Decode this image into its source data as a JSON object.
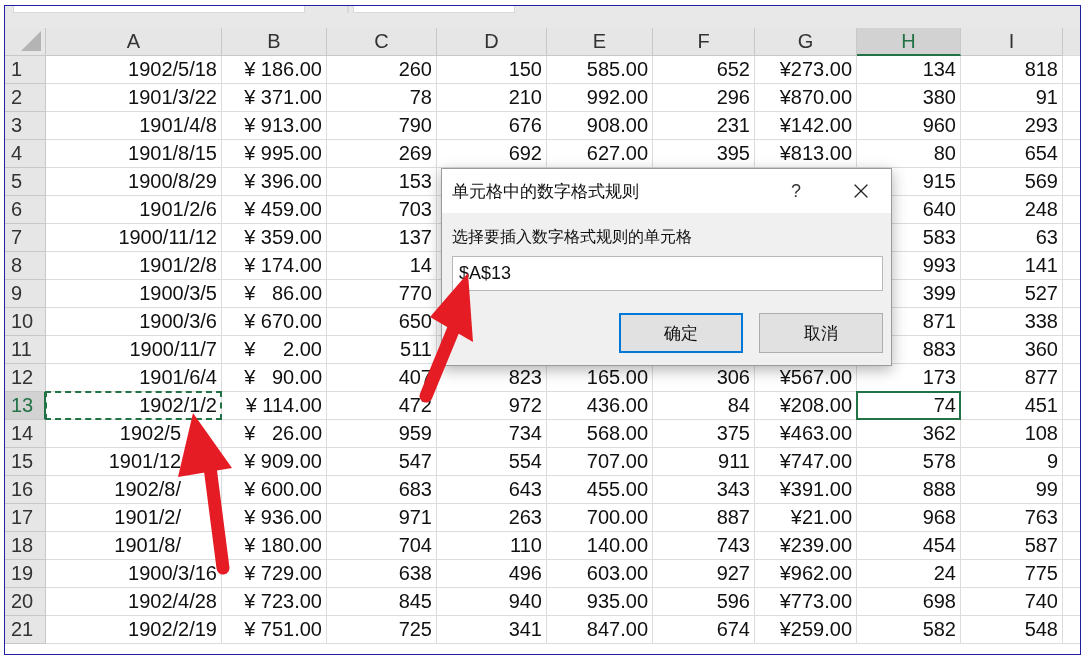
{
  "columns": [
    {
      "label": "A",
      "selected": false,
      "marquee": true
    },
    {
      "label": "B",
      "selected": false,
      "marquee": false
    },
    {
      "label": "C",
      "selected": false,
      "marquee": false
    },
    {
      "label": "D",
      "selected": false,
      "marquee": false
    },
    {
      "label": "E",
      "selected": false,
      "marquee": false
    },
    {
      "label": "F",
      "selected": false,
      "marquee": false
    },
    {
      "label": "G",
      "selected": false,
      "marquee": false
    },
    {
      "label": "H",
      "selected": true,
      "marquee": false
    },
    {
      "label": "I",
      "selected": false,
      "marquee": false
    }
  ],
  "rows": [
    {
      "label": "1",
      "selected": false,
      "cells": [
        "1902/5/18",
        "¥ 186.00",
        "260",
        "150",
        "585.00",
        "652",
        "¥273.00",
        "134",
        "818"
      ]
    },
    {
      "label": "2",
      "selected": false,
      "cells": [
        "1901/3/22",
        "¥ 371.00",
        "78",
        "210",
        "992.00",
        "296",
        "¥870.00",
        "380",
        "91"
      ]
    },
    {
      "label": "3",
      "selected": false,
      "cells": [
        "1901/4/8",
        "¥ 913.00",
        "790",
        "676",
        "908.00",
        "231",
        "¥142.00",
        "960",
        "293"
      ]
    },
    {
      "label": "4",
      "selected": false,
      "cells": [
        "1901/8/15",
        "¥ 995.00",
        "269",
        "692",
        "627.00",
        "395",
        "¥813.00",
        "80",
        "654"
      ]
    },
    {
      "label": "5",
      "selected": false,
      "cells": [
        "1900/8/29",
        "¥ 396.00",
        "153",
        null,
        null,
        null,
        null,
        "915",
        "569"
      ]
    },
    {
      "label": "6",
      "selected": false,
      "cells": [
        "1901/2/6",
        "¥ 459.00",
        "703",
        null,
        null,
        null,
        null,
        "640",
        "248"
      ]
    },
    {
      "label": "7",
      "selected": false,
      "cells": [
        "1900/11/12",
        "¥ 359.00",
        "137",
        null,
        null,
        null,
        null,
        "583",
        "63"
      ]
    },
    {
      "label": "8",
      "selected": false,
      "cells": [
        "1901/2/8",
        "¥ 174.00",
        "14",
        null,
        null,
        null,
        null,
        "993",
        "141"
      ]
    },
    {
      "label": "9",
      "selected": false,
      "cells": [
        "1900/3/5",
        "¥   86.00",
        "770",
        null,
        null,
        null,
        null,
        "399",
        "527"
      ]
    },
    {
      "label": "10",
      "selected": false,
      "cells": [
        "1900/3/6",
        "¥ 670.00",
        "650",
        null,
        null,
        null,
        null,
        "871",
        "338"
      ]
    },
    {
      "label": "11",
      "selected": false,
      "cells": [
        "1900/11/7",
        "¥     2.00",
        "511",
        null,
        null,
        null,
        null,
        "883",
        "360"
      ]
    },
    {
      "label": "12",
      "selected": false,
      "cells": [
        "1901/6/4",
        "¥   90.00",
        "407",
        "823",
        "165.00",
        "306",
        "¥567.00",
        "173",
        "877"
      ]
    },
    {
      "label": "13",
      "selected": true,
      "cells": [
        "1902/1/2",
        "¥ 114.00",
        "472",
        "972",
        "436.00",
        "84",
        "¥208.00",
        "74",
        "451"
      ]
    },
    {
      "label": "14",
      "selected": false,
      "obscured": true,
      "cells": [
        "1902/5",
        "¥   26.00",
        "959",
        "734",
        "568.00",
        "375",
        "¥463.00",
        "362",
        "108"
      ]
    },
    {
      "label": "15",
      "selected": false,
      "obscured": true,
      "cells": [
        "1901/12",
        "¥ 909.00",
        "547",
        "554",
        "707.00",
        "911",
        "¥747.00",
        "578",
        "9"
      ]
    },
    {
      "label": "16",
      "selected": false,
      "obscured": true,
      "cells": [
        "1902/8/",
        "¥ 600.00",
        "683",
        "643",
        "455.00",
        "343",
        "¥391.00",
        "888",
        "99"
      ]
    },
    {
      "label": "17",
      "selected": false,
      "obscured": true,
      "cells": [
        "1901/2/",
        "¥ 936.00",
        "971",
        "263",
        "700.00",
        "887",
        "¥21.00",
        "968",
        "763"
      ]
    },
    {
      "label": "18",
      "selected": false,
      "obscured": true,
      "cells": [
        "1901/8/",
        "¥ 180.00",
        "704",
        "110",
        "140.00",
        "743",
        "¥239.00",
        "454",
        "587"
      ]
    },
    {
      "label": "19",
      "selected": false,
      "cells": [
        "1900/3/16",
        "¥ 729.00",
        "638",
        "496",
        "603.00",
        "927",
        "¥962.00",
        "24",
        "775"
      ]
    },
    {
      "label": "20",
      "selected": false,
      "cells": [
        "1902/4/28",
        "¥ 723.00",
        "845",
        "940",
        "935.00",
        "596",
        "¥773.00",
        "698",
        "740"
      ]
    },
    {
      "label": "21",
      "selected": false,
      "cells": [
        "1902/2/19",
        "¥ 751.00",
        "725",
        "341",
        "847.00",
        "674",
        "¥259.00",
        "582",
        "548"
      ]
    }
  ],
  "dialog": {
    "title": "单元格中的数字格式规则",
    "help": "?",
    "label": "选择要插入数字格式规则的单元格",
    "value": "$A$13",
    "buttons": [
      {
        "label": "确定",
        "default": true
      },
      {
        "label": "取消",
        "default": false
      }
    ]
  }
}
